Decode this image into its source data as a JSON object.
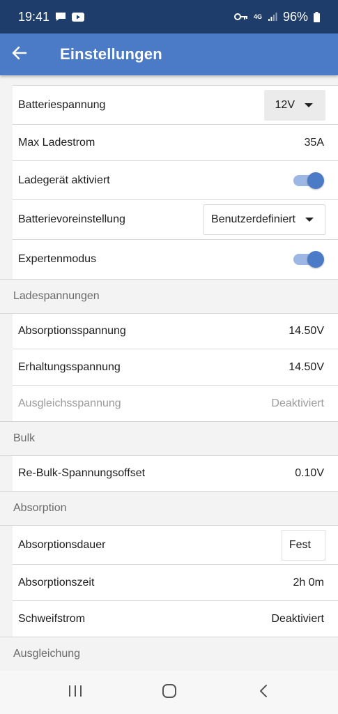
{
  "status_bar": {
    "time": "19:41",
    "network": "4G",
    "battery": "96%"
  },
  "app_bar": {
    "title": "Einstellungen"
  },
  "general": [
    {
      "label": "Batteriespannung",
      "value": "12V"
    },
    {
      "label": "Max Ladestrom",
      "value": "35A"
    },
    {
      "label": "Ladegerät aktiviert",
      "toggle_on": true
    },
    {
      "label": "Batterievoreinstellung",
      "value": "Benutzerdefiniert"
    },
    {
      "label": "Expertenmodus",
      "toggle_on": true
    }
  ],
  "sections": {
    "ladespannungen": {
      "header": "Ladespannungen",
      "rows": [
        {
          "label": "Absorptionsspannung",
          "value": "14.50V"
        },
        {
          "label": "Erhaltungsspannung",
          "value": "14.50V"
        },
        {
          "label": "Ausgleichsspannung",
          "value": "Deaktiviert",
          "disabled": true
        }
      ]
    },
    "bulk": {
      "header": "Bulk",
      "rows": [
        {
          "label": "Re-Bulk-Spannungsoffset",
          "value": "0.10V"
        }
      ]
    },
    "absorption": {
      "header": "Absorption",
      "rows": [
        {
          "label": "Absorptionsdauer",
          "value": "Fest"
        },
        {
          "label": "Absorptionszeit",
          "value": "2h 0m"
        },
        {
          "label": "Schweifstrom",
          "value": "Deaktiviert"
        }
      ]
    },
    "ausgleichung": {
      "header": "Ausgleichung"
    }
  },
  "icons": {
    "back": "arrow-left-icon",
    "message": "message-icon",
    "youtube": "youtube-icon",
    "key": "key-icon",
    "signal": "signal-icon",
    "battery": "battery-icon",
    "recents": "recents-icon",
    "home": "home-icon",
    "nav_back": "chevron-left-icon"
  },
  "colors": {
    "status_bar": "#1f3d6b",
    "app_bar": "#4b7ac6",
    "toggle_track": "#9cb7e3",
    "toggle_thumb": "#4b7ac6"
  }
}
